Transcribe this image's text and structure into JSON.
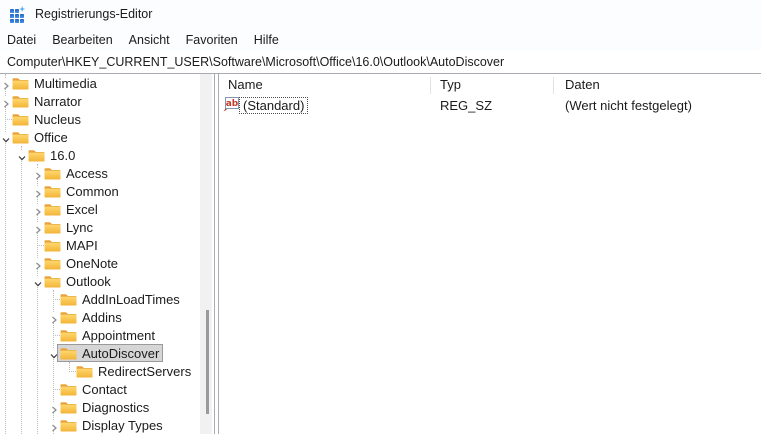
{
  "window": {
    "title": "Registrierungs-Editor",
    "icon": "registry-icon"
  },
  "menu": {
    "items": [
      "Datei",
      "Bearbeiten",
      "Ansicht",
      "Favoriten",
      "Hilfe"
    ]
  },
  "address": {
    "path": "Computer\\HKEY_CURRENT_USER\\Software\\Microsoft\\Office\\16.0\\Outlook\\AutoDiscover"
  },
  "tree": {
    "items": [
      {
        "label": "Multimedia",
        "level": 1,
        "state": "collapsed",
        "selected": false
      },
      {
        "label": "Narrator",
        "level": 1,
        "state": "collapsed",
        "selected": false
      },
      {
        "label": "Nucleus",
        "level": 1,
        "state": "none",
        "selected": false
      },
      {
        "label": "Office",
        "level": 1,
        "state": "expanded",
        "selected": false
      },
      {
        "label": "16.0",
        "level": 2,
        "state": "expanded",
        "selected": false
      },
      {
        "label": "Access",
        "level": 3,
        "state": "collapsed",
        "selected": false
      },
      {
        "label": "Common",
        "level": 3,
        "state": "collapsed",
        "selected": false
      },
      {
        "label": "Excel",
        "level": 3,
        "state": "collapsed",
        "selected": false
      },
      {
        "label": "Lync",
        "level": 3,
        "state": "collapsed",
        "selected": false
      },
      {
        "label": "MAPI",
        "level": 3,
        "state": "none",
        "selected": false
      },
      {
        "label": "OneNote",
        "level": 3,
        "state": "collapsed",
        "selected": false
      },
      {
        "label": "Outlook",
        "level": 3,
        "state": "expanded",
        "selected": false
      },
      {
        "label": "AddInLoadTimes",
        "level": 4,
        "state": "none",
        "selected": false
      },
      {
        "label": "Addins",
        "level": 4,
        "state": "collapsed",
        "selected": false
      },
      {
        "label": "Appointment",
        "level": 4,
        "state": "none",
        "selected": false
      },
      {
        "label": "AutoDiscover",
        "level": 4,
        "state": "expanded",
        "selected": true
      },
      {
        "label": "RedirectServers",
        "level": 5,
        "state": "none",
        "selected": false
      },
      {
        "label": "Contact",
        "level": 4,
        "state": "none",
        "selected": false
      },
      {
        "label": "Diagnostics",
        "level": 4,
        "state": "collapsed",
        "selected": false
      },
      {
        "label": "Display Types",
        "level": 4,
        "state": "collapsed",
        "selected": false
      }
    ]
  },
  "list": {
    "columns": [
      "Name",
      "Typ",
      "Daten"
    ],
    "rows": [
      {
        "icon": "string-value-icon",
        "name": "(Standard)",
        "type": "REG_SZ",
        "data": "(Wert nicht festgelegt)",
        "focused": true
      }
    ]
  },
  "colors": {
    "selection_bg": "#d6d6d6",
    "folder_front": "#f6bd43",
    "folder_back": "#e8a33c",
    "app_icon_blue": "#2a70cf",
    "value_icon_red": "#c2392b"
  }
}
